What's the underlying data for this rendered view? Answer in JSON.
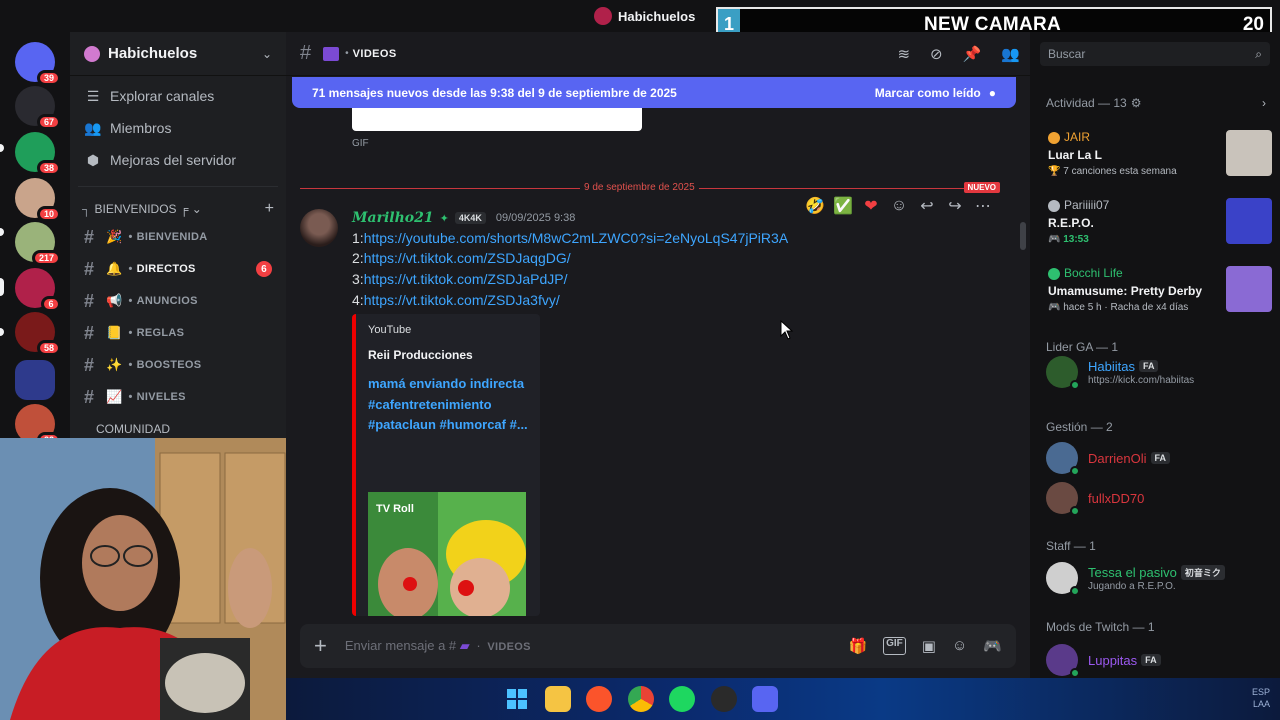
{
  "window": {
    "title": "Habichuelos"
  },
  "overlay": {
    "number": "1",
    "text": "NEW CAMARA",
    "right": "20"
  },
  "rail": {
    "servers": [
      {
        "name": "discord-home",
        "badge": "39",
        "color": "#5865f2"
      },
      {
        "name": "server-2",
        "badge": "67",
        "color": "#2a2a30"
      },
      {
        "name": "server-3",
        "badge": "38",
        "color": "#1f9e5a"
      },
      {
        "name": "server-4",
        "badge": "10",
        "color": "#c9a48b"
      },
      {
        "name": "server-5",
        "badge": "217",
        "color": "#9ab37a"
      },
      {
        "name": "server-6",
        "badge": "6",
        "color": "#b0214a"
      },
      {
        "name": "server-7",
        "badge": "58",
        "color": "#7a1a1a"
      },
      {
        "name": "folder",
        "badge": "",
        "color": "#2e3a8c"
      },
      {
        "name": "server-9",
        "badge": "22",
        "color": "#c0503a"
      }
    ]
  },
  "guild": {
    "name": "Habichuelos",
    "nav": [
      {
        "label": "Explorar canales",
        "icon": "☰"
      },
      {
        "label": "Miembros",
        "icon": "👥"
      },
      {
        "label": "Mejoras del servidor",
        "icon": "⬢"
      }
    ],
    "category": "BIENVENIDOS ╒ ⌄",
    "channels": [
      {
        "name": "BIENVENIDA",
        "emoji": "🎉",
        "active": false,
        "badge": ""
      },
      {
        "name": "DIRECTOS",
        "emoji": "🔔",
        "active": true,
        "badge": "6"
      },
      {
        "name": "ANUNCIOS",
        "emoji": "📢",
        "active": false,
        "badge": ""
      },
      {
        "name": "REGLAS",
        "emoji": "📒",
        "active": false,
        "badge": ""
      },
      {
        "name": "BOOSTEOS",
        "emoji": "✨",
        "active": false,
        "badge": ""
      },
      {
        "name": "NIVELES",
        "emoji": "📈",
        "active": false,
        "badge": ""
      }
    ],
    "next_category": "COMUNIDAD"
  },
  "chat": {
    "channel": "VIDEOS",
    "new_bar": {
      "text": "71 mensajes nuevos desde las 9:38 del 9 de septiembre de 2025",
      "action": "Marcar como leído"
    },
    "gif_label": "GIF",
    "divider_date": "9 de septiembre de 2025",
    "divider_new": "NUEVO",
    "message": {
      "author": "Marilho21",
      "tag": "4K4K",
      "timestamp": "09/09/2025 9:38",
      "lines": [
        {
          "prefix": "1:",
          "url": "https://youtube.com/shorts/M8wC2mLZWC0?si=2eNyoLqS47jPiR3A"
        },
        {
          "prefix": "2:",
          "url": "https://vt.tiktok.com/ZSDJaqgDG/"
        },
        {
          "prefix": "3:",
          "url": "https://vt.tiktok.com/ZSDJaPdJP/"
        },
        {
          "prefix": "4:",
          "url": "https://vt.tiktok.com/ZSDJa3fvy/"
        }
      ],
      "embed": {
        "provider": "YouTube",
        "author": "Reii Producciones",
        "title": "mamá enviando indirecta #cafentretenimiento #pataclaun #humorcaf #...",
        "thumb_label": "TV Roll"
      }
    },
    "composer": {
      "placeholder_prefix": "Enviar mensaje a #",
      "placeholder_channel": "VIDEOS"
    }
  },
  "members": {
    "search_placeholder": "Buscar",
    "activity_header": "Actividad — 13",
    "activities": [
      {
        "user": "JAIR",
        "user_color": "#f0a232",
        "game": "Luar La L",
        "detail": "🏆 7 canciones esta semana",
        "thumb": "#c9c3bb"
      },
      {
        "user": "Pariiiii07",
        "user_color": "#b5bac1",
        "game": "R.E.P.O.",
        "detail": "🎮 13:53",
        "detail_color": "#2ec070",
        "thumb": "#3a42c8"
      },
      {
        "user": "Bocchi Life",
        "user_color": "#2ec070",
        "game": "Umamusume: Pretty Derby",
        "detail": "🎮 hace 5 h · Racha de x4 días",
        "thumb": "#8a6ad4"
      }
    ],
    "groups": [
      {
        "title": "Lider GA — 1",
        "members": [
          {
            "name": "Habiitas",
            "color": "#3ea6ff",
            "tag": "FA",
            "sub": "https://kick.com/habiitas",
            "avatar": "#2d5c2c"
          }
        ]
      },
      {
        "title": "Gestión — 2",
        "members": [
          {
            "name": "DarrienOli",
            "color": "#d9363e",
            "tag": "FA",
            "sub": "",
            "avatar": "#4a6a92"
          },
          {
            "name": "fullxDD70",
            "color": "#d9363e",
            "tag": "",
            "sub": "",
            "avatar": "#6a4a42"
          }
        ]
      },
      {
        "title": "Staff — 1",
        "members": [
          {
            "name": "Tessa el pasivo",
            "color": "#2ec070",
            "tag": "初音ミク",
            "sub": "Jugando a R.E.P.O.",
            "avatar": "#cfcfcf"
          }
        ]
      },
      {
        "title": "Mods de Twitch — 1",
        "members": [
          {
            "name": "Luppitas",
            "color": "#9b59f0",
            "tag": "FA",
            "sub": "",
            "avatar": "#5a3a8a"
          }
        ]
      }
    ]
  },
  "taskbar": {
    "tray_line1": "ESP",
    "tray_line2": "LAA"
  }
}
